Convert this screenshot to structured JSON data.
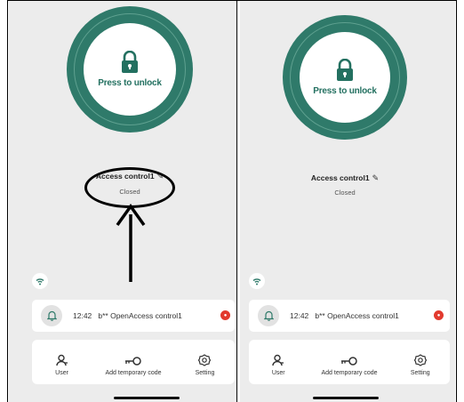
{
  "panels": [
    {
      "unlock_label": "Press to unlock",
      "device_name": "Access control1",
      "device_status": "Closed",
      "notification": {
        "time": "12:42",
        "text": "b** OpenAccess control1"
      },
      "tabs": [
        {
          "label": "User",
          "icon": "user-icon"
        },
        {
          "label": "Add temporary code",
          "icon": "key-icon"
        },
        {
          "label": "Setting",
          "icon": "gear-icon"
        }
      ]
    },
    {
      "unlock_label": "Press to unlock",
      "device_name": "Access control1",
      "device_status": "Closed",
      "notification": {
        "time": "12:42",
        "text": "b** OpenAccess control1"
      },
      "tabs": [
        {
          "label": "User",
          "icon": "user-icon"
        },
        {
          "label": "Add temporary code",
          "icon": "key-icon"
        },
        {
          "label": "Setting",
          "icon": "gear-icon"
        }
      ]
    }
  ],
  "colors": {
    "brand_green": "#2f7a6a",
    "unlock_text": "#237060",
    "badge_red": "#e23a2e",
    "background": "#ececec"
  }
}
